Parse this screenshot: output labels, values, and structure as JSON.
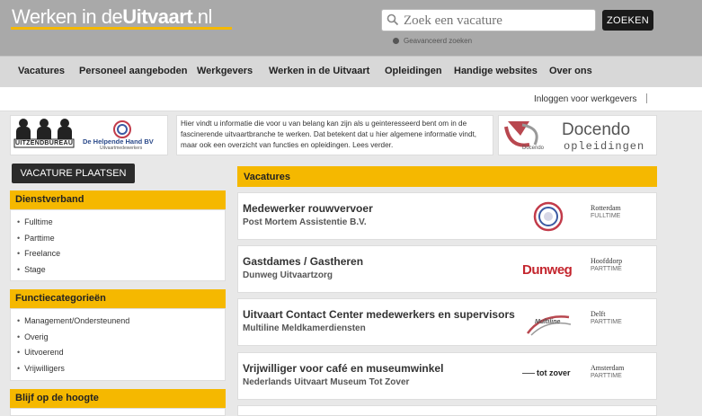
{
  "header": {
    "logo_light": "Werken in de",
    "logo_bold": "Uitvaart",
    "logo_suffix": ".nl",
    "search_placeholder": "Zoek een vacature",
    "search_button": "ZOEKEN",
    "advanced_search": "Geavanceerd zoeken"
  },
  "nav": {
    "items": [
      "Vacatures",
      "Personeel aangeboden",
      "Werkgevers",
      "Werken in de Uitvaart",
      "Opleidingen",
      "Handige websites",
      "Over ons"
    ]
  },
  "loginbar": {
    "login_label": "Inloggen voor werkgevers"
  },
  "banners": {
    "uitzendbureau_label": "UITZENDBUREAU",
    "helpende_hand_name": "De Helpende Hand BV",
    "helpende_hand_sub": "Uitvaartmedewerkers",
    "intro_text": "Hier vindt u informatie die voor u van belang kan zijn als u geinteresseerd bent om in de fascinerende uitvaartbranche te werken. Dat betekent dat u hier algemene informatie vindt, maar ook een overzicht van functies en opleidingen. Lees verder.",
    "docendo_title": "Docendo",
    "docendo_sub": "opleidingen",
    "docendo_small": "Docendo"
  },
  "sidebar": {
    "post_button": "VACATURE PLAATSEN",
    "dienstverband": {
      "title": "Dienstverband",
      "items": [
        "Fulltime",
        "Parttime",
        "Freelance",
        "Stage"
      ]
    },
    "functiecategorieen": {
      "title": "Functiecategorieën",
      "items": [
        "Management/Ondersteunend",
        "Overig",
        "Uitvoerend",
        "Vrijwilligers"
      ]
    },
    "blijf": {
      "title": "Blijf op de hoogte"
    }
  },
  "vacatures": {
    "title": "Vacatures",
    "items": [
      {
        "title": "Medewerker rouwvervoer",
        "org": "Post Mortem Assistentie B.V.",
        "city": "Rotterdam",
        "type": "FULLTIME",
        "logo": "post-mortem-logo"
      },
      {
        "title": "Gastdames / Gastheren",
        "org": "Dunweg Uitvaartzorg",
        "city": "Hoofddorp",
        "type": "PARTTIME",
        "logo": "dunweg-logo",
        "logo_text": "Dunweg"
      },
      {
        "title": "Uitvaart Contact Center medewerkers en supervisors",
        "org": "Multiline Meldkamerdiensten",
        "city": "Delft",
        "type": "PARTTIME",
        "logo": "multiline-logo",
        "logo_text": "Multiline"
      },
      {
        "title": "Vrijwilliger voor café en museumwinkel",
        "org": "Nederlands Uitvaart Museum Tot Zover",
        "city": "Amsterdam",
        "type": "PARTTIME",
        "logo": "tot-zover-logo",
        "logo_text": "tot zover"
      }
    ]
  },
  "colors": {
    "accent": "#f5b800",
    "header_bg": "#a9a9a9",
    "nav_bg": "#d8d8d8"
  }
}
